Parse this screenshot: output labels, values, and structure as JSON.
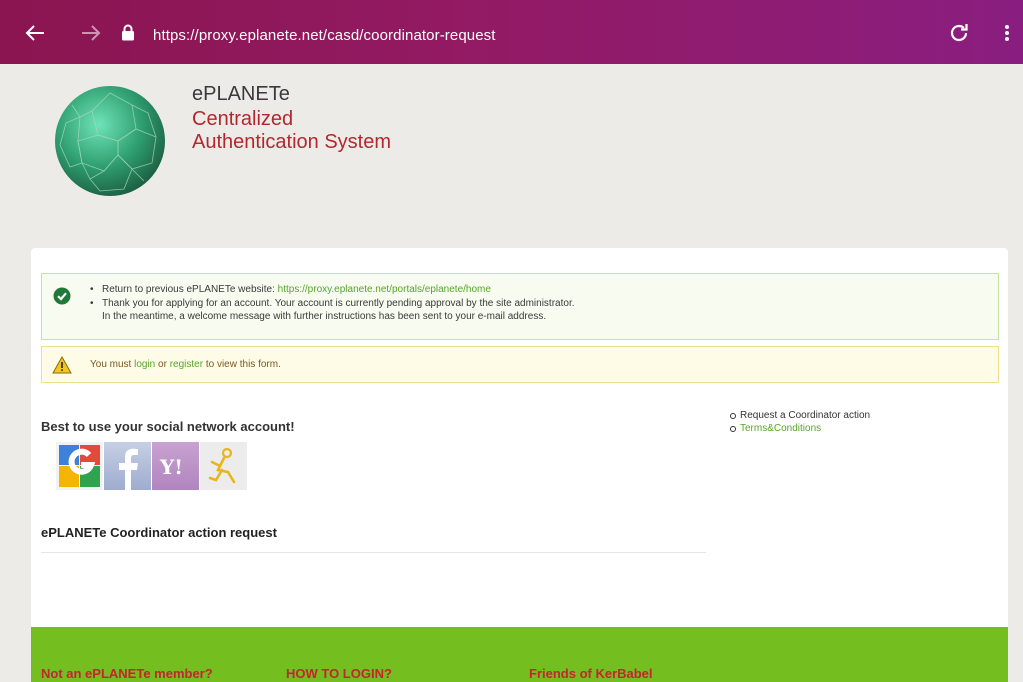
{
  "browser": {
    "url": "https://proxy.eplanete.net/casd/coordinator-request"
  },
  "header": {
    "site_name": "ePLANETe",
    "subtitle_line1": "Centralized",
    "subtitle_line2": "Authentication System"
  },
  "messages": {
    "success": {
      "item1_text": "Return to previous ePLANETe website: ",
      "item1_link": "https://proxy.eplanete.net/portals/eplanete/home",
      "item2_line1": "Thank you for applying for an account. Your account is currently pending approval by the site administrator.",
      "item2_line2": "In the meantime, a welcome message with further instructions has been sent to your e-mail address."
    },
    "warning": {
      "prefix": "You must ",
      "login_link": "login",
      "middle": " or ",
      "register_link": "register",
      "suffix": " to view this form."
    }
  },
  "social": {
    "title": "Best to use your social network account!",
    "providers": [
      "google-icon",
      "facebook-icon",
      "yahoo-icon",
      "aol-icon"
    ]
  },
  "sidebar": {
    "item1": "Request a Coordinator action",
    "item2": "Terms&Conditions"
  },
  "main": {
    "section_title": "ePLANETe Coordinator action request"
  },
  "footer": {
    "col1": "Not an ePLANETe member?",
    "col2": "HOW TO LOGIN?",
    "col3": "Friends of KerBabel"
  },
  "colors": {
    "brand_red": "#b3282d",
    "link_green": "#56a629",
    "footer_green": "#74be20",
    "browser_bar": "#8a1550"
  }
}
